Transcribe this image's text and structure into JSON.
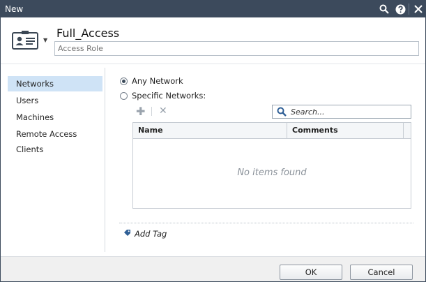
{
  "window": {
    "title": "New"
  },
  "object": {
    "name": "Full_Access",
    "comment_placeholder": "Access Role"
  },
  "nav": {
    "items": [
      {
        "label": "Networks",
        "active": true
      },
      {
        "label": "Users",
        "active": false
      },
      {
        "label": "Machines",
        "active": false
      },
      {
        "label": "Remote Access Clients",
        "active": false
      }
    ]
  },
  "networks": {
    "options": [
      {
        "label": "Any Network",
        "checked": true
      },
      {
        "label": "Specific Networks:",
        "checked": false
      }
    ],
    "search_placeholder": "Search...",
    "table": {
      "columns": [
        "Name",
        "Comments"
      ],
      "empty_text": "No items found"
    },
    "add_tag_label": "Add Tag"
  },
  "footer": {
    "ok_label": "OK",
    "cancel_label": "Cancel"
  },
  "icons": [
    "search-icon",
    "help-icon",
    "close-icon",
    "access-role-icon",
    "chevron-down-icon",
    "plus-icon",
    "delete-icon",
    "tag-icon"
  ],
  "colors": {
    "titlebar": "#3c4a5c",
    "nav_active": "#cfe3f6"
  }
}
